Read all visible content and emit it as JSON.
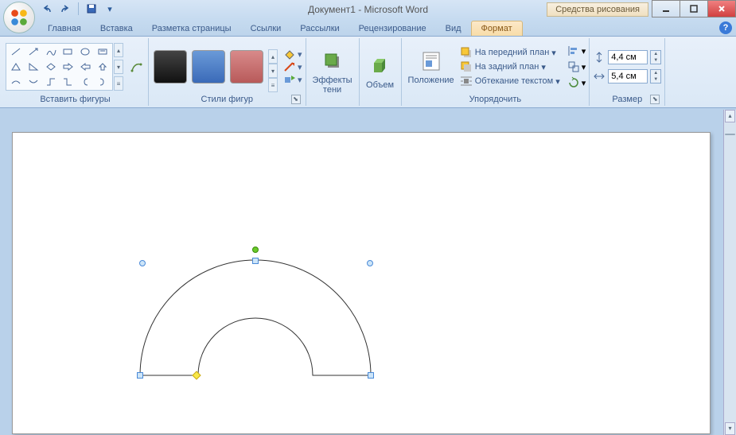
{
  "title": "Документ1 - Microsoft Word",
  "context_tab": "Средства рисования",
  "tabs": {
    "home": "Главная",
    "insert": "Вставка",
    "layout": "Разметка страницы",
    "references": "Ссылки",
    "mailings": "Рассылки",
    "review": "Рецензирование",
    "view": "Вид",
    "format": "Формат"
  },
  "groups": {
    "insert_shapes": "Вставить фигуры",
    "shape_styles": "Стили фигур",
    "shadow": "Эффекты тени",
    "volume": "Объем",
    "position": "Положение",
    "arrange": "Упорядочить",
    "size": "Размер"
  },
  "buttons": {
    "shadow": "Эффекты\nтени",
    "volume": "Объем",
    "position": "Положение",
    "bring_front": "На передний план",
    "send_back": "На задний план",
    "text_wrap": "Обтекание текстом"
  },
  "size": {
    "height": "4,4 см",
    "width": "5,4 см"
  },
  "colors": {
    "swatch1": "#222",
    "swatch2": "#4a7ac8",
    "swatch3": "#c86a6a"
  }
}
